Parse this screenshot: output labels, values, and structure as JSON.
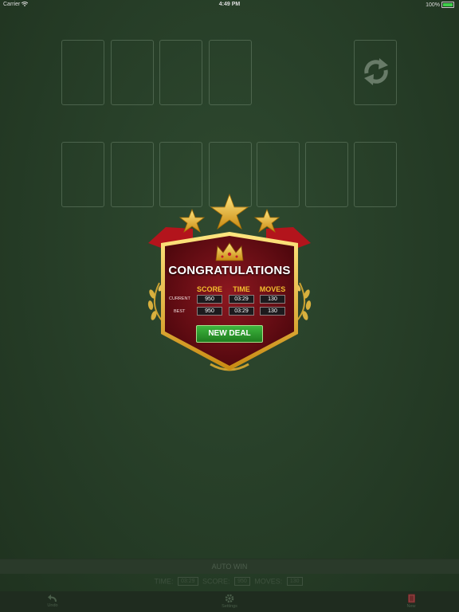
{
  "status_bar": {
    "carrier": "Carrier",
    "time": "4:49 PM",
    "battery": "100%"
  },
  "board": {
    "foundation_slots": 4,
    "stock_icon": "recycle-icon",
    "tableau_slots": 7
  },
  "dialog": {
    "title": "CONGRATULATIONS",
    "columns": [
      "SCORE",
      "TIME",
      "MOVES"
    ],
    "rows": [
      {
        "label": "CURRENT",
        "score": "950",
        "time": "03:29",
        "moves": "130"
      },
      {
        "label": "BEST",
        "score": "950",
        "time": "03:29",
        "moves": "130"
      }
    ],
    "button": "NEW DEAL",
    "stars": 3,
    "icon": "crown-icon"
  },
  "auto_win": "AUTO WIN",
  "stats": {
    "time_label": "TIME:",
    "time": "03:29",
    "score_label": "SCORE:",
    "score": "950",
    "moves_label": "MOVES:",
    "moves": "130"
  },
  "toolbar": {
    "undo": "Undo",
    "undo_icon": "undo-icon",
    "settings": "Settings",
    "settings_icon": "gear-icon",
    "new": "New",
    "new_icon": "new-deal-icon"
  },
  "colors": {
    "felt": "#263d27",
    "accent_gold": "#f3bf2e",
    "badge_red": "#6b0e14",
    "button_green": "#2a9a2a"
  }
}
